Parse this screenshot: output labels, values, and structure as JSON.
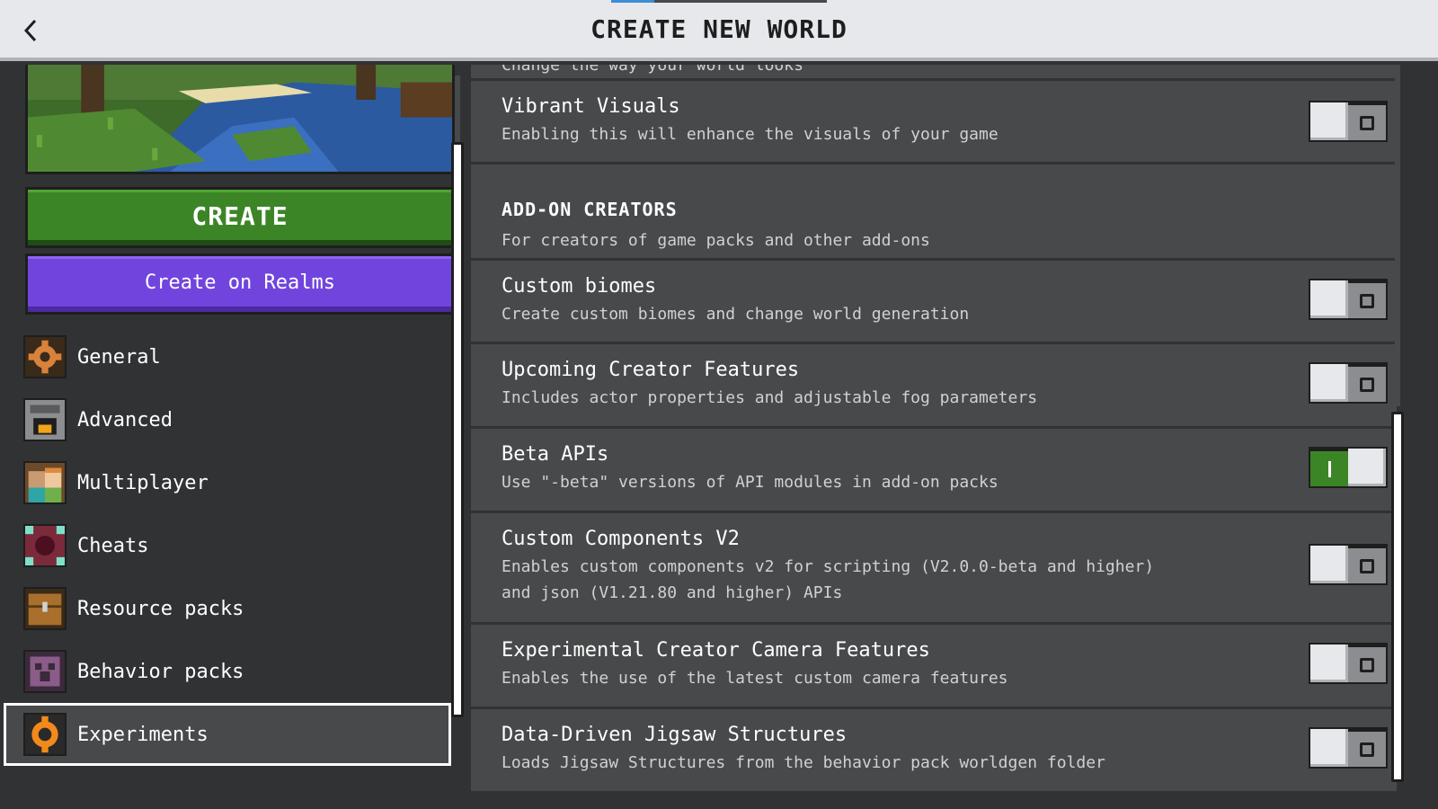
{
  "header": {
    "title": "CREATE NEW WORLD",
    "back_icon": "chevron-left-icon"
  },
  "left": {
    "create_label": "CREATE",
    "realms_label": "Create on Realms",
    "nav": [
      {
        "label": "General",
        "icon": "gear-icon"
      },
      {
        "label": "Advanced",
        "icon": "furnace-icon"
      },
      {
        "label": "Multiplayer",
        "icon": "players-icon"
      },
      {
        "label": "Cheats",
        "icon": "command-block-icon"
      },
      {
        "label": "Resource packs",
        "icon": "chest-icon"
      },
      {
        "label": "Behavior packs",
        "icon": "creeper-icon"
      },
      {
        "label": "Experiments",
        "icon": "experiments-icon",
        "selected": true
      }
    ]
  },
  "right": {
    "clipped_text": "Change the way your world looks",
    "vibrant": {
      "title": "Vibrant Visuals",
      "desc": "Enabling this will enhance the visuals of your game",
      "on": false
    },
    "addon_section": {
      "title": "ADD-ON CREATORS",
      "desc": "For creators of game packs and other add-ons"
    },
    "settings": [
      {
        "title": "Custom biomes",
        "desc": "Create custom biomes and change world generation",
        "on": false
      },
      {
        "title": "Upcoming Creator Features",
        "desc": "Includes actor properties and adjustable fog parameters",
        "on": false
      },
      {
        "title": "Beta APIs",
        "desc": "Use \"-beta\" versions of API modules in add-on packs",
        "on": true
      },
      {
        "title": "Custom Components V2",
        "desc1": "Enables custom components v2 for scripting (V2.0.0-beta and higher)",
        "desc2": "and json (V1.21.80 and higher) APIs",
        "on": false
      },
      {
        "title": "Experimental Creator Camera Features",
        "desc": "Enables the use of the latest custom camera features",
        "on": false
      },
      {
        "title": "Data-Driven Jigsaw Structures",
        "desc": "Loads Jigsaw Structures from the behavior pack worldgen folder",
        "on": false
      }
    ]
  },
  "colors": {
    "create_green": "#3c8527",
    "realms_purple": "#7145dd",
    "panel_dark": "#313233",
    "row_gray": "#48494a",
    "header_light": "#e6e8eb",
    "toggle_on": "#3c8527"
  }
}
